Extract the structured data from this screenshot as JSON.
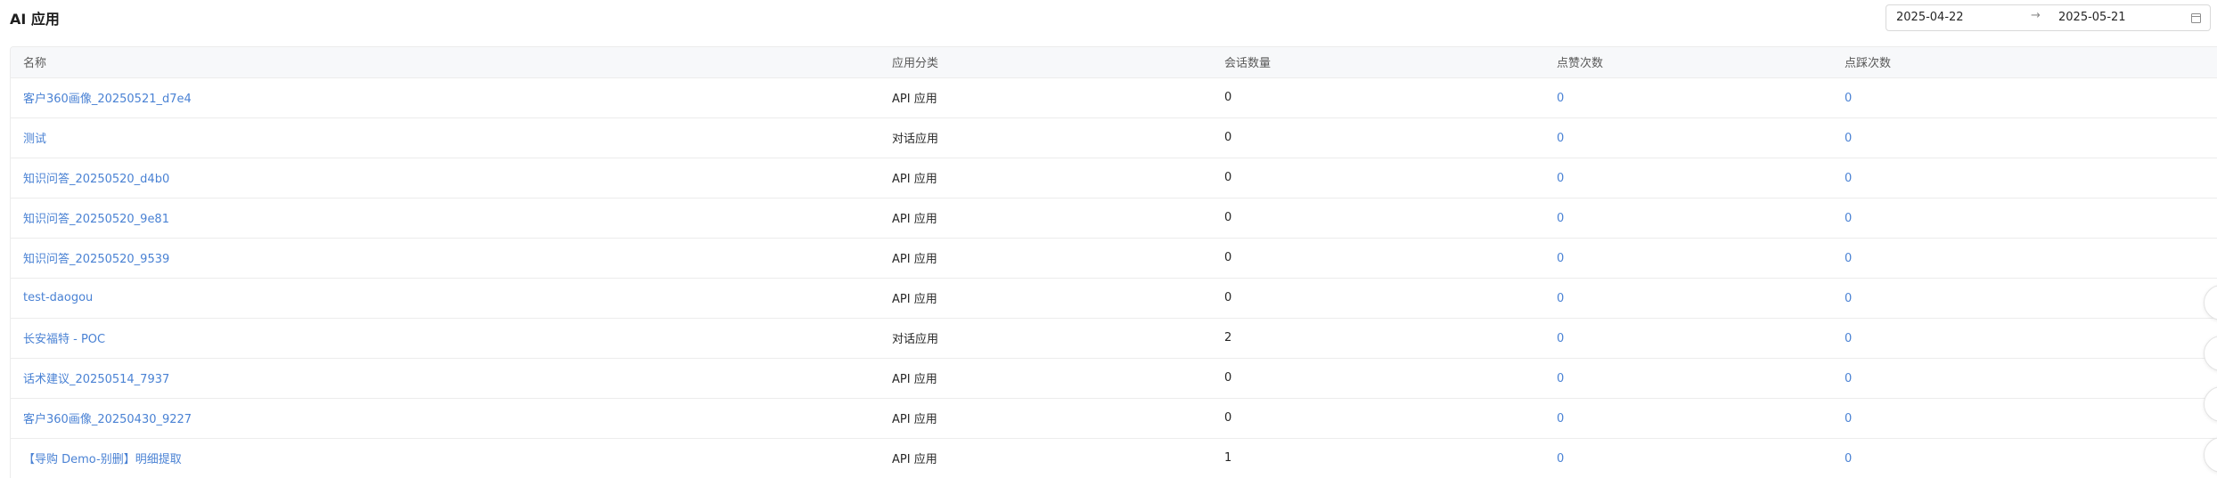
{
  "header": {
    "title": "AI 应用"
  },
  "date_range": {
    "start": "2025-04-22",
    "separator": "→",
    "end": "2025-05-21",
    "icon": "calendar-icon"
  },
  "table": {
    "columns": [
      "名称",
      "应用分类",
      "会话数量",
      "点赞次数",
      "点踩次数"
    ],
    "rows": [
      {
        "name": "客户360画像_20250521_d7e4",
        "category": "API 应用",
        "sessions": "0",
        "likes": "0",
        "dislikes": "0"
      },
      {
        "name": "测试",
        "category": "对话应用",
        "sessions": "0",
        "likes": "0",
        "dislikes": "0"
      },
      {
        "name": "知识问答_20250520_d4b0",
        "category": "API 应用",
        "sessions": "0",
        "likes": "0",
        "dislikes": "0"
      },
      {
        "name": "知识问答_20250520_9e81",
        "category": "API 应用",
        "sessions": "0",
        "likes": "0",
        "dislikes": "0"
      },
      {
        "name": "知识问答_20250520_9539",
        "category": "API 应用",
        "sessions": "0",
        "likes": "0",
        "dislikes": "0"
      },
      {
        "name": "test-daogou",
        "category": "API 应用",
        "sessions": "0",
        "likes": "0",
        "dislikes": "0"
      },
      {
        "name": "长安福特 - POC",
        "category": "对话应用",
        "sessions": "2",
        "likes": "0",
        "dislikes": "0"
      },
      {
        "name": "话术建议_20250514_7937",
        "category": "API 应用",
        "sessions": "0",
        "likes": "0",
        "dislikes": "0"
      },
      {
        "name": "客户360画像_20250430_9227",
        "category": "API 应用",
        "sessions": "0",
        "likes": "0",
        "dislikes": "0"
      },
      {
        "name": "【导购 Demo-别删】明细提取",
        "category": "API 应用",
        "sessions": "1",
        "likes": "0",
        "dislikes": "0"
      }
    ]
  },
  "colors": {
    "link": "#4a82d4",
    "header_bg": "#f7f8fa",
    "border": "#ececec"
  }
}
